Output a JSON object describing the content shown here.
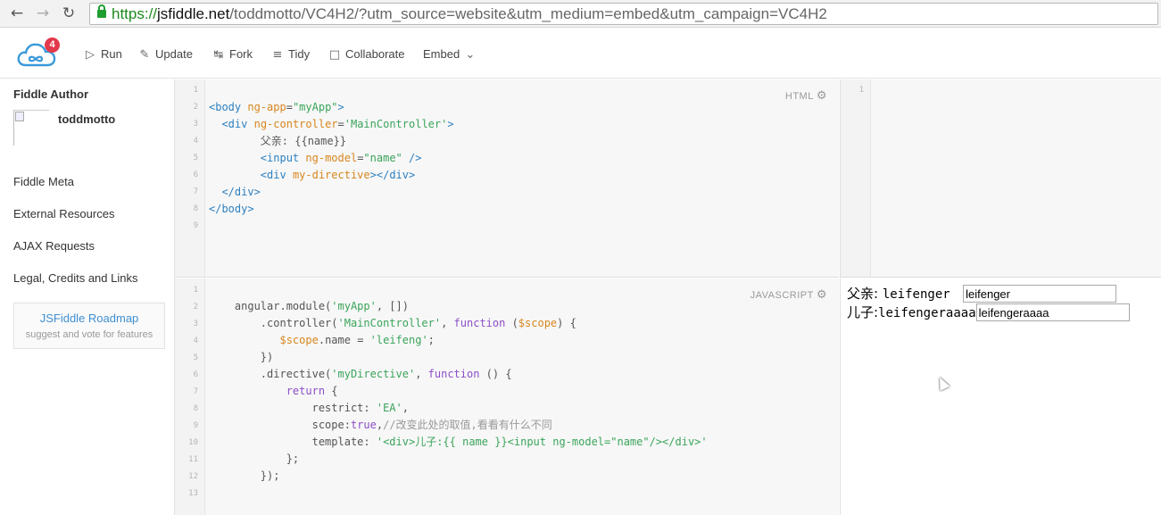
{
  "browser": {
    "url_scheme": "https://",
    "url_host": "jsfiddle.net",
    "url_rest": "/toddmotto/VC4H2/?utm_source=website&utm_medium=embed&utm_campaign=VC4H2"
  },
  "logo": {
    "badge": "4"
  },
  "toolbar": {
    "run": "Run",
    "update": "Update",
    "fork": "Fork",
    "tidy": "Tidy",
    "collaborate": "Collaborate",
    "embed": "Embed"
  },
  "sidebar": {
    "author_title": "Fiddle Author",
    "author_name": "toddmotto",
    "meta": "Fiddle Meta",
    "external": "External Resources",
    "ajax": "AJAX Requests",
    "legal": "Legal, Credits and Links",
    "roadmap_title": "JSFiddle Roadmap",
    "roadmap_sub": "suggest and vote for features"
  },
  "html_panel": {
    "label": "HTML",
    "line_numbers": [
      "1",
      "2",
      "3",
      "4",
      "5",
      "6",
      "7",
      "8",
      "9"
    ],
    "lines": [
      "",
      "<body ng-app=\"myApp\">",
      "  <div ng-controller='MainController'>",
      "        父亲: {{name}}",
      "        <input ng-model=\"name\" />",
      "        <div my-directive></div>",
      "  </div>",
      "</body>",
      ""
    ]
  },
  "js_panel": {
    "label": "JAVASCRIPT",
    "line_numbers": [
      "1",
      "2",
      "3",
      "4",
      "5",
      "6",
      "7",
      "8",
      "9",
      "10",
      "11",
      "12",
      "13"
    ],
    "lines": [
      "",
      "    angular.module('myApp', [])",
      "        .controller('MainController', function ($scope) {",
      "           $scope.name = 'leifeng';",
      "        })",
      "        .directive('myDirective', function () {",
      "            return {",
      "                restrict: 'EA',",
      "                scope:true,//改变此处的取值,看看有什么不同",
      "                template: '<div>儿子:{{ name }}<input ng-model=\"name\"/></div>'",
      "            };",
      "        });",
      ""
    ]
  },
  "css_panel": {
    "line_numbers": [
      "1"
    ]
  },
  "result": {
    "parent_label": "父亲: ",
    "parent_text": "leifenger ",
    "parent_input": "leifenger",
    "child_label": "儿子:",
    "child_text": "leifengeraaaa",
    "child_input": "leifengeraaaa"
  },
  "colors": {
    "tag": "#2e80c0",
    "attribute": "#d6861e",
    "string": "#3aa45a",
    "keyword": "#8d4ec7",
    "logo_blue": "#3a9ad9",
    "badge_red": "#e2394b"
  }
}
